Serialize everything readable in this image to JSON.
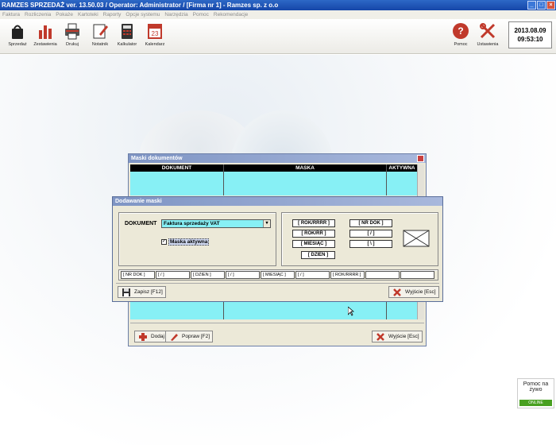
{
  "window": {
    "app_name": "RAMZES SPRZEDAŻ ver. 13.50.03 /",
    "operator": "Operator: Administrator /",
    "firm": "[Firma nr 1] - Ramzes sp. z o.o"
  },
  "menu": [
    "Faktura",
    "Rozliczenia",
    "Pokaże",
    "Kartoteki",
    "Raporty",
    "Opcje systemu",
    "Narzędzia",
    "Pomoc",
    "Rekomendacje"
  ],
  "toolbar": {
    "sprzedaz": "Sprzedaż",
    "zestawienia": "Zestawienia",
    "drukuj": "Drukuj",
    "notatnik": "Notatnik",
    "kalkulator": "Kalkulator",
    "kalendarz": "Kalendarz",
    "kalendarz_day": "23",
    "pomoc": "Pomoc",
    "ustawienia": "Ustawienia"
  },
  "clock": {
    "date": "2013.08.09",
    "time": "09:53:10"
  },
  "masks_dialog": {
    "title": "Maski dokumentów",
    "columns": [
      "DOKUMENT",
      "MASKA",
      "AKTYWNA"
    ],
    "dodaj": "Dodaj   [Ins]",
    "popraw": "Popraw   [F2]",
    "wyjscie": "Wyjście  [Esc]"
  },
  "add_dialog": {
    "title": "Dodawanie maski",
    "dokument_label": "DOKUMENT",
    "dokument_value": "Faktura sprzedaży VAT",
    "checkbox_label": "Maska aktywna",
    "checkbox_checked": true,
    "tags": {
      "rok_rrrr": "[ ROK/RRRR ]",
      "rok_rr": "[ ROK/RR ]",
      "miesiac": "[ MIESIĄC ]",
      "dzien": "[ DZIEN ]",
      "nr_dok": "[ NR DOK ]",
      "slash": "[ / ]",
      "backslash": "[ \\ ]"
    },
    "mask_cells": [
      "[ NR DOK ]",
      "[ / ]",
      "[ DZIEN ]",
      "[ / ]",
      "[ MIESIĄC ]",
      "[ / ]",
      "[ ROK/RRRR ]",
      "",
      ""
    ],
    "zapisz": "Zapisz  [F12]",
    "wyjscie": "Wyjście  [Esc]"
  },
  "help": {
    "label_line1": "Pomoc na",
    "label_line2": "żywo",
    "status": "ONLINE"
  }
}
